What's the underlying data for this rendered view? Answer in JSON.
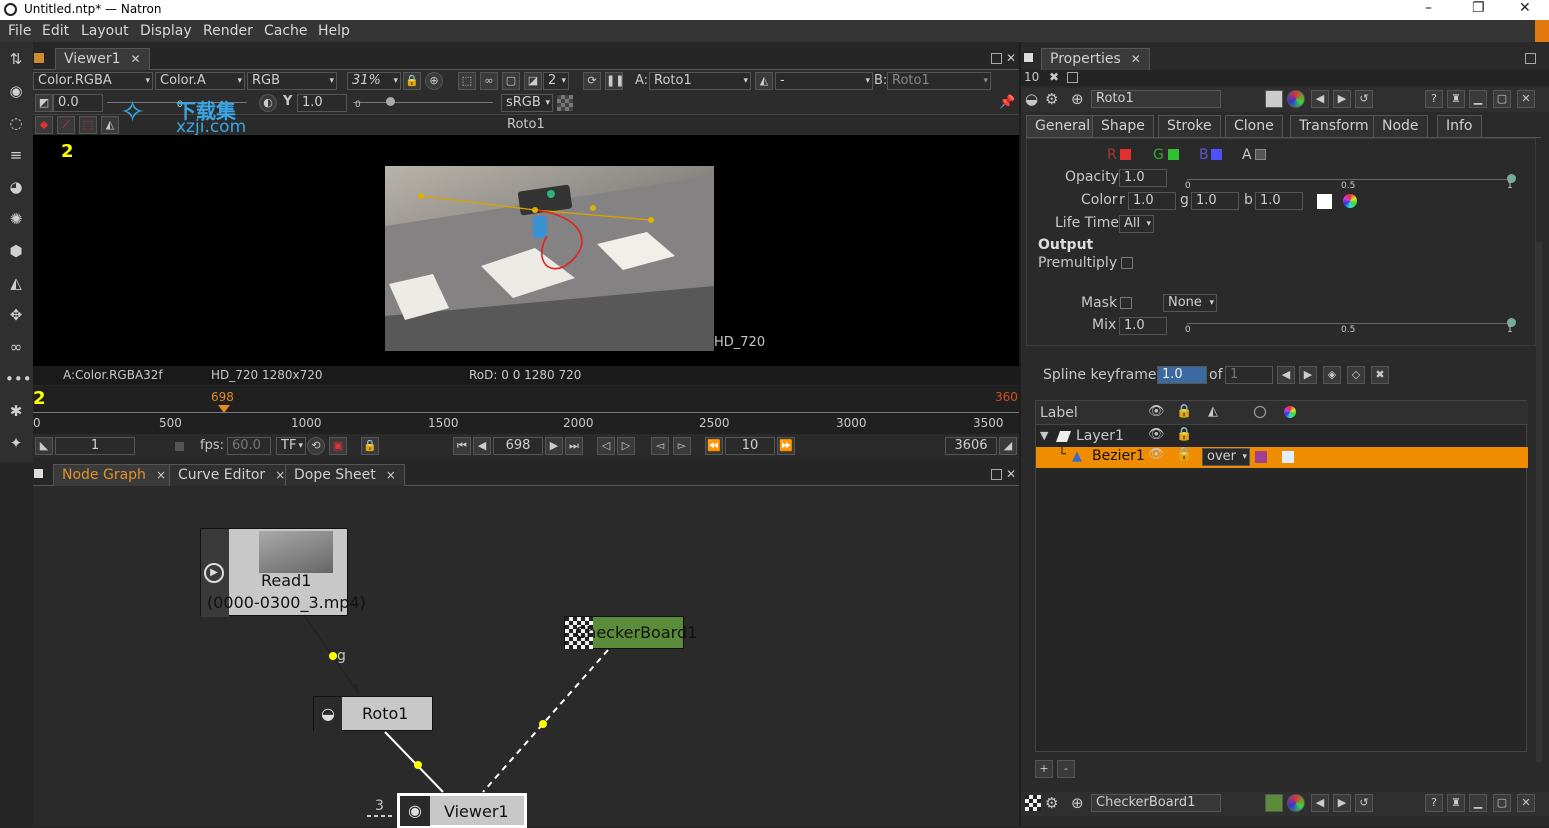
{
  "window": {
    "title": "Untitled.ntp* — Natron",
    "minimize": "–",
    "maximize": "❐",
    "close": "✕"
  },
  "menu": [
    "File",
    "Edit",
    "Layout",
    "Display",
    "Render",
    "Cache",
    "Help"
  ],
  "viewer": {
    "tab_label": "Viewer1",
    "channels": "Color.RGBA",
    "alpha_channel": "Color.A",
    "colorspace_mode": "RGB",
    "zoom": "31%",
    "proxy_level": "2",
    "input_a_label": "A:",
    "input_a": "Roto1",
    "wipe_mode": "-",
    "input_b_label": "B:",
    "input_b": "Roto1",
    "gain": "0.0",
    "gamma_label": "Y",
    "gamma": "1.0",
    "gain_slider_min": "0",
    "lut": "sRGB",
    "node_name": "Roto1",
    "format_label": "HD_720",
    "info_channels": "A:Color.RGBA32f",
    "info_format": "HD_720 1280x720",
    "info_rod": "RoD: 0 0 1280 720",
    "left_marker": "2"
  },
  "timeline": {
    "current_frame_marker": "698",
    "end_marker": "360",
    "left_marker": "2",
    "ticks": [
      "0",
      "500",
      "1000",
      "1500",
      "2000",
      "2500",
      "3000",
      "3500"
    ],
    "start_frame": "1",
    "fps_label": "fps:",
    "fps": "60.0",
    "playback_mode": "TF",
    "current_frame": "698",
    "increment": "10",
    "end_frame": "3606"
  },
  "bottom_tabs": [
    {
      "label": "Node Graph",
      "close": "×"
    },
    {
      "label": "Curve Editor",
      "close": "×"
    },
    {
      "label": "Dope Sheet",
      "close": "×"
    }
  ],
  "node_graph": {
    "read_node": {
      "name": "Read1",
      "file": "(0000-0300_3.mp4)"
    },
    "roto_node": "Roto1",
    "checker_node": "CheckerBoard1",
    "viewer_node": "Viewer1",
    "edge_label": "g",
    "input_number": "3"
  },
  "properties": {
    "tab_label": "Properties",
    "max_panels": "10",
    "node_name": "Roto1",
    "tabs": [
      "General",
      "Shape",
      "Stroke",
      "Clone",
      "Transform",
      "Node",
      "Info"
    ],
    "channels": [
      "R",
      "G",
      "B",
      "A"
    ],
    "opacity_label": "Opacity",
    "opacity": "1.0",
    "color_label": "Color",
    "color_r_label": "r",
    "color_r": "1.0",
    "color_g_label": "g",
    "color_g": "1.0",
    "color_b_label": "b",
    "color_b": "1.0",
    "lifetime_label": "Life Time",
    "lifetime": "All",
    "output_heading": "Output",
    "premultiply_label": "Premultiply",
    "mask_label": "Mask",
    "mask_value": "None",
    "mix_label": "Mix",
    "mix": "1.0",
    "slider_ticks": [
      "0",
      "0.5",
      "1"
    ],
    "spline_label": "Spline keyframe:",
    "spline_value": "1.0",
    "spline_of": "of",
    "spline_total": "1",
    "table_label_header": "Label",
    "layer": "Layer1",
    "bezier": "Bezier1",
    "bezier_op": "over",
    "add": "+",
    "remove": "-",
    "second_node": "CheckerBoard1",
    "colors": {
      "accent": "#f08c00",
      "panel": "#2d2d2d"
    }
  },
  "watermark": {
    "line1": "下载集",
    "line2": "xzji.com"
  }
}
